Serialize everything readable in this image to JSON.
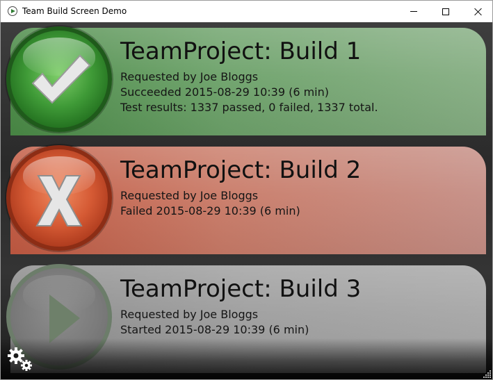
{
  "window": {
    "title": "Team Build Screen Demo",
    "app_icon": "play-circle-icon",
    "controls": [
      "minimize-icon",
      "maximize-icon",
      "close-icon"
    ]
  },
  "builds": [
    {
      "title": "TeamProject: Build 1",
      "requested_by": "Requested by Joe Bloggs",
      "status_line": "Succeeded 2015-08-29 10:39 (6 min)",
      "tests_line": "Test results: 1337 passed, 0 failed, 1337 total.",
      "status": "succeeded",
      "status_icon": "checkmark-icon",
      "color": "#4a8a46"
    },
    {
      "title": "TeamProject: Build 2",
      "requested_by": "Requested by Joe Bloggs",
      "status_line": "Failed 2015-08-29 10:39 (6 min)",
      "status": "failed",
      "status_icon": "x-icon",
      "color": "#c25a42"
    },
    {
      "title": "TeamProject: Build 3",
      "requested_by": "Requested by Joe Bloggs",
      "status_line": "Started 2015-08-29 10:39 (6 min)",
      "status": "in-progress",
      "status_icon": "play-icon",
      "color": "#8a8a8a"
    }
  ],
  "footer": {
    "settings_icon": "gears-icon",
    "resize_icon": "resize-grip-icon"
  }
}
